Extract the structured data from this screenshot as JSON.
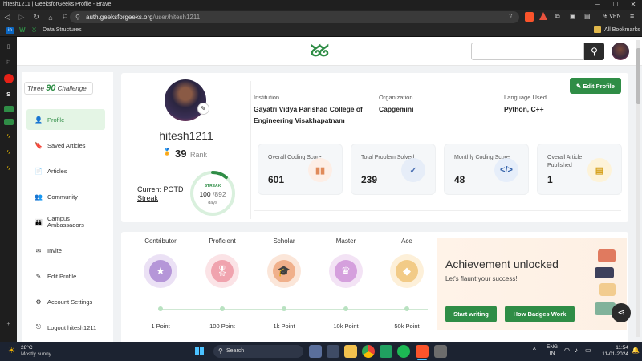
{
  "browser": {
    "window_title": "hitesh1211 | GeeksforGeeks Profile - Brave",
    "url_host": "auth.geeksforgeeks.org",
    "url_path": "/user/hitesh1211",
    "vpn_label": "VPN",
    "bookmarks": [
      "Data Structures"
    ],
    "all_bookmarks_label": "All Bookmarks"
  },
  "site": {
    "logo_text": "ᘜᘜ",
    "search_placeholder": ""
  },
  "sidebar": {
    "challenge_prefix": "Three",
    "challenge_number": "90",
    "challenge_suffix": "Challenge",
    "items": [
      {
        "label": "Profile",
        "icon": "user-icon",
        "glyph": "👤",
        "active": true
      },
      {
        "label": "Saved Articles",
        "icon": "bookmark-icon",
        "glyph": "🔖",
        "active": false
      },
      {
        "label": "Articles",
        "icon": "document-icon",
        "glyph": "📄",
        "active": false
      },
      {
        "label": "Community",
        "icon": "people-icon",
        "glyph": "👥",
        "active": false
      },
      {
        "label": "Campus Ambassadors",
        "icon": "group-icon",
        "glyph": "👨‍👩‍👦",
        "active": false
      },
      {
        "label": "Invite",
        "icon": "mail-icon",
        "glyph": "✉",
        "active": false
      },
      {
        "label": "Edit Profile",
        "icon": "pencil-icon",
        "glyph": "✎",
        "active": false
      },
      {
        "label": "Account Settings",
        "icon": "gear-icon",
        "glyph": "⚙",
        "active": false
      },
      {
        "label": "Logout hitesh1211",
        "icon": "logout-icon",
        "glyph": "⎋",
        "active": false
      }
    ]
  },
  "profile": {
    "username": "hitesh1211",
    "rank": "39",
    "rank_label": "Rank",
    "potd_label_1": "Current POTD",
    "potd_label_2": "Streak",
    "streak_label": "STREAK",
    "streak_current": "100",
    "streak_total": "/892",
    "streak_unit": "days",
    "streak_fraction": 0.112,
    "institution_label": "Institution",
    "institution": "Gayatri Vidya Parishad College of Engineering Visakhapatnam",
    "organization_label": "Organization",
    "organization": "Capgemini",
    "language_label": "Language Used",
    "language": "Python, C++",
    "edit_button": "Edit Profile"
  },
  "stats": [
    {
      "title": "Overall Coding Score",
      "value": "601",
      "icon": "bar-chart-icon",
      "bg": "#fdeee6",
      "fg": "#e08a5a"
    },
    {
      "title": "Total Problem Solved",
      "value": "239",
      "icon": "check-circle-icon",
      "bg": "#e6edf8",
      "fg": "#4a6fb3"
    },
    {
      "title": "Monthly Coding Score",
      "value": "48",
      "icon": "code-icon",
      "bg": "#e6eefa",
      "fg": "#2f5ea8"
    },
    {
      "title": "Overall Article Published",
      "value": "1",
      "icon": "article-icon",
      "bg": "#fdf3d9",
      "fg": "#d6a21e"
    }
  ],
  "badges": [
    {
      "name": "Contributor",
      "points": "1 Point",
      "icon": "star-icon",
      "bg": "#ebe1f5",
      "fg": "#b596d8",
      "glyph": "★"
    },
    {
      "name": "Proficient",
      "points": "100 Point",
      "icon": "ribbon-icon",
      "bg": "#fbe3e6",
      "fg": "#f0a3ae",
      "glyph": "🎖"
    },
    {
      "name": "Scholar",
      "points": "1k Point",
      "icon": "graduation-cap-icon",
      "bg": "#fbe6d9",
      "fg": "#f0b08b",
      "glyph": "🎓"
    },
    {
      "name": "Master",
      "points": "10k Point",
      "icon": "crown-icon",
      "bg": "#f3e3f5",
      "fg": "#d5a0dd",
      "glyph": "♛"
    },
    {
      "name": "Ace",
      "points": "50k Point",
      "icon": "diamond-icon",
      "bg": "#fdf0d9",
      "fg": "#f2cb87",
      "glyph": "◆"
    }
  ],
  "achievement": {
    "title": "Achievement unlocked",
    "subtitle": "Let's flaunt your success!",
    "btn_write": "Start writing",
    "btn_badges": "How Badges Work"
  },
  "taskbar": {
    "temperature": "28°C",
    "weather": "Mostly sunny",
    "search_label": "Search",
    "lang_1": "ENG",
    "lang_2": "IN",
    "time": "11:54",
    "date": "11-01-2024"
  }
}
